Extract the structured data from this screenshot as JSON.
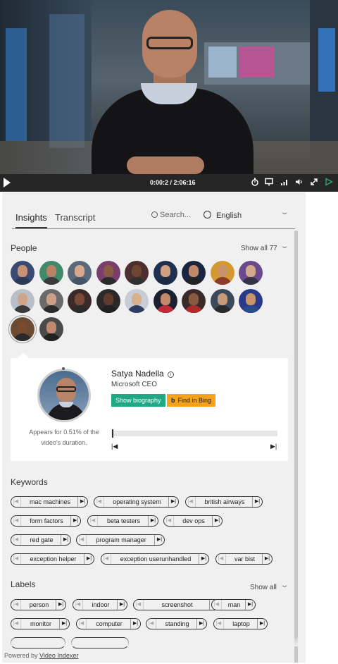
{
  "player": {
    "time": "0:00:2 / 2:06:16"
  },
  "tabs": [
    {
      "label": "Insights",
      "active": true
    },
    {
      "label": "Transcript",
      "active": false
    }
  ],
  "search": {
    "placeholder": "Search..."
  },
  "language": {
    "label": "English"
  },
  "people": {
    "title": "People",
    "show_all": "Show all 77",
    "avatars": [
      {
        "skin": "#c99273",
        "clothes": "#2b3a55",
        "bg": "#3b4a73"
      },
      {
        "skin": "#b98266",
        "clothes": "#3a3a3a",
        "bg": "#3f8a6a"
      },
      {
        "skin": "#d7a88c",
        "clothes": "#445566",
        "bg": "#5b6a7a"
      },
      {
        "skin": "#8a5a44",
        "clothes": "#2a2a2a",
        "bg": "#7a3e6a"
      },
      {
        "skin": "#6d4530",
        "clothes": "#303030",
        "bg": "#4d2f2f"
      },
      {
        "skin": "#d0a080",
        "clothes": "#1d2a44",
        "bg": "#203050"
      },
      {
        "skin": "#c08a6a",
        "clothes": "#222222",
        "bg": "#1a2640"
      },
      {
        "skin": "#c8926c",
        "clothes": "#8c3a2a",
        "bg": "#d49a30"
      },
      {
        "skin": "#d2a88a",
        "clothes": "#333344",
        "bg": "#6a4a8a"
      },
      {
        "skin": "#cfa58b",
        "clothes": "#3a3a3a",
        "bg": "#b8bfc8"
      },
      {
        "skin": "#caa088",
        "clothes": "#2a2a2a",
        "bg": "#6a6a6a"
      },
      {
        "skin": "#7a4a36",
        "clothes": "#2a2a2a",
        "bg": "#3a2a2a"
      },
      {
        "skin": "#5e3b2a",
        "clothes": "#202020",
        "bg": "#2a2a2a"
      },
      {
        "skin": "#d8b090",
        "clothes": "#2c3f60",
        "bg": "#c8ccd6"
      },
      {
        "skin": "#c28a6a",
        "clothes": "#c22a3a",
        "bg": "#1a2030"
      },
      {
        "skin": "#8a5a40",
        "clothes": "#b02a2a",
        "bg": "#3a2a2a"
      },
      {
        "skin": "#c89a7c",
        "clothes": "#2a2a2a",
        "bg": "#3a4a5a"
      },
      {
        "skin": "#c8956a",
        "clothes": "#2a4a8a",
        "bg": "#2a3a8a"
      },
      {
        "skin": "#7a4a30",
        "clothes": "#2a2a2a",
        "bg": "#6a4a30"
      },
      {
        "skin": "#c08a70",
        "clothes": "#222222",
        "bg": "#4a4a4a"
      }
    ]
  },
  "person_card": {
    "name": "Satya Nadella",
    "title": "Microsoft CEO",
    "biography_button": "Show biography",
    "bing_button": "Find in Bing",
    "bing_icon": "b",
    "appears_text": "Appears for 0.51% of the video's duration.",
    "appearance_fraction": 0.0051
  },
  "keywords": {
    "title": "Keywords",
    "rows": [
      [
        "mac machines",
        "operating system",
        "british airways"
      ],
      [
        "form factors",
        "beta testers",
        "dev ops"
      ],
      [
        "red gate",
        "program manager"
      ],
      [
        "exception helper",
        "exception userunhandled",
        "var bist"
      ]
    ]
  },
  "labels": {
    "title": "Labels",
    "show_all": "Show all",
    "rows": [
      [
        "person",
        "indoor",
        "screenshot",
        "man"
      ],
      [
        "monitor",
        "computer",
        "standing",
        "laptop"
      ]
    ]
  },
  "footer": {
    "prefix": "Powered by",
    "link": "Video Indexer"
  },
  "icons": {
    "chip_prev": "|◀",
    "chip_next": "▶|",
    "timeline_prev": "|◀",
    "timeline_next": "▶|",
    "chevron": "⌄"
  }
}
